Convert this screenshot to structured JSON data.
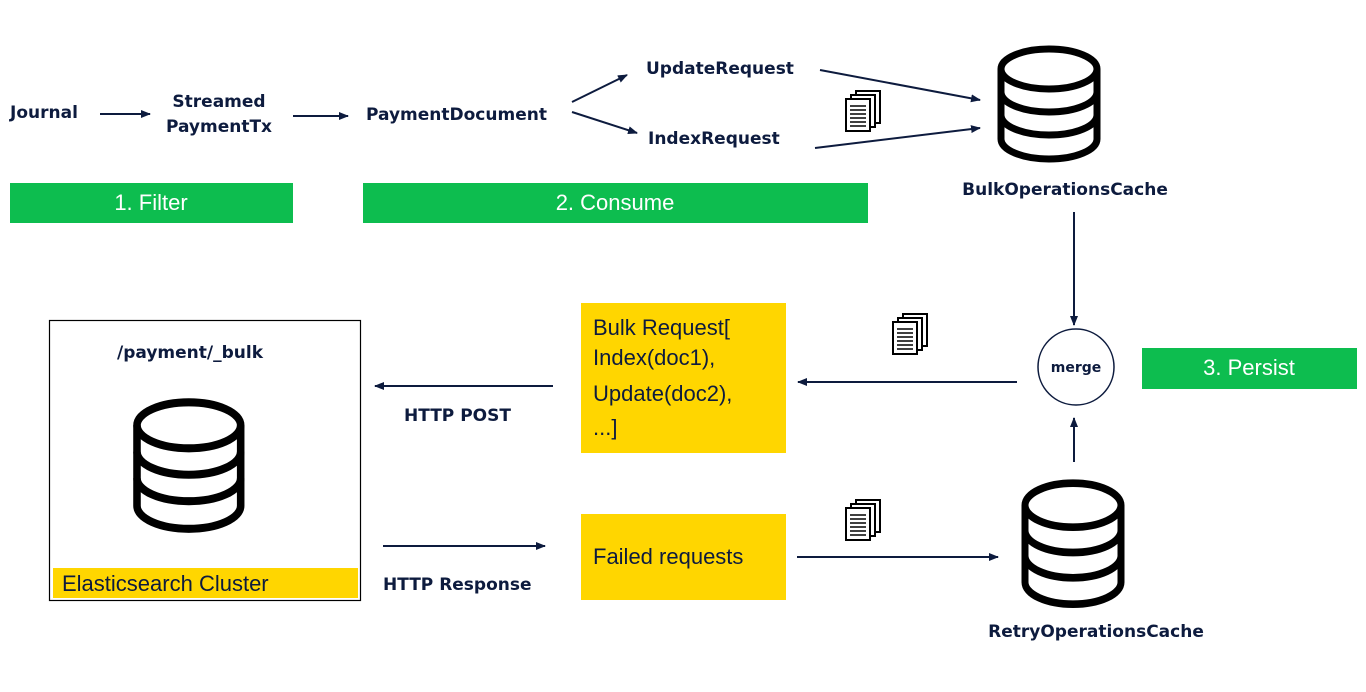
{
  "colors": {
    "green": "#0dbd4f",
    "yellow": "#ffd600",
    "text": "#0d1b3e"
  },
  "nodes": {
    "journal": "Journal",
    "streamed_1": "Streamed",
    "streamed_2": "PaymentTx",
    "payment_document": "PaymentDocument",
    "update_request": "UpdateRequest",
    "index_request": "IndexRequest",
    "bulk_cache": "BulkOperationsCache",
    "retry_cache": "RetryOperationsCache",
    "merge": "merge",
    "endpoint": "/payment/_bulk",
    "cluster": "Elasticsearch Cluster",
    "http_post": "HTTP POST",
    "http_response": "HTTP Response",
    "failed": "Failed requests",
    "bulk_request": [
      "Bulk Request[",
      "Index(doc1),",
      "Update(doc2),",
      "...]"
    ]
  },
  "stages": [
    "1. Filter",
    "2. Consume",
    "3. Persist"
  ],
  "icons": [
    "database-icon",
    "documents-icon",
    "arrow-icon"
  ]
}
